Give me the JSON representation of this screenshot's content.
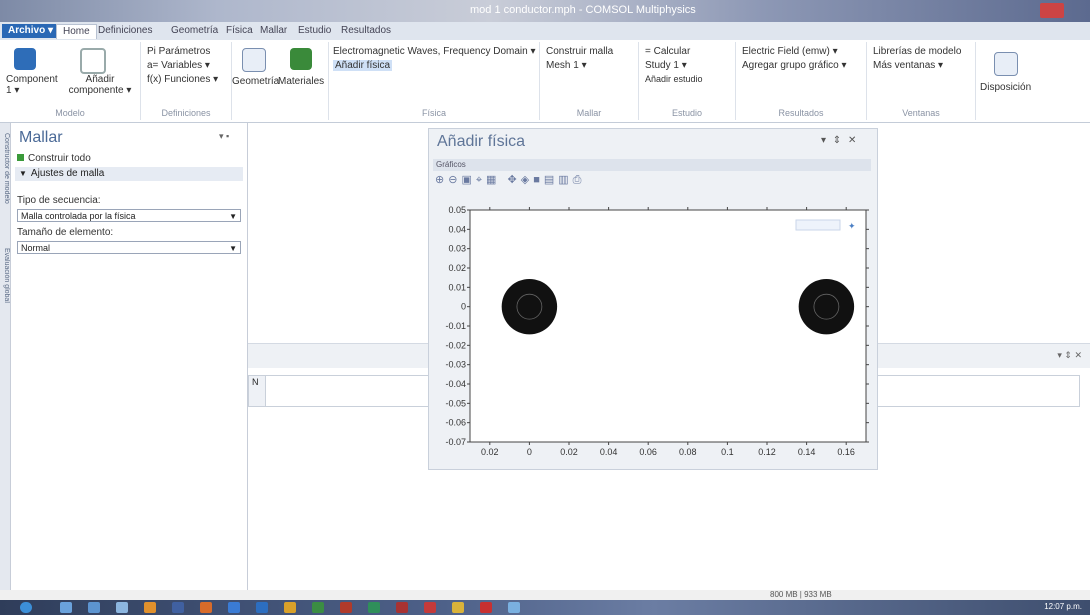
{
  "window": {
    "title": "mod 1 conductor.mph - COMSOL Multiphysics"
  },
  "tabs": [
    {
      "label": "Archivo ▾"
    },
    {
      "label": "Home"
    },
    {
      "label": "Definiciones"
    },
    {
      "label": "Geometría"
    },
    {
      "label": "Física"
    },
    {
      "label": "Mallar"
    },
    {
      "label": "Estudio"
    },
    {
      "label": "Resultados"
    }
  ],
  "ribbon": {
    "component": "Component 1 ▾",
    "add_component": "Añadir componente ▾",
    "parameters": "Pi Parámetros",
    "variables": "a= Variables ▾",
    "functions": "f(x) Funciones ▾",
    "geometry": "Geometría",
    "materials": "Materiales",
    "physics_item": "Electromagnetic Waves, Frequency Domain ▾",
    "add_physics": "Añadir física",
    "build_mesh": "Construir malla",
    "mesh": "Mesh 1 ▾",
    "compute": "= Calcular",
    "study": "Study 1 ▾",
    "add_study": "Añadir estudio",
    "plot1": "Electric Field (emw) ▾",
    "add_plot": "Agregar grupo gráfico ▾",
    "libraries": "Librerías de modelo",
    "more_windows": "Más ventanas ▾",
    "layout": "Disposición",
    "groups": {
      "model": "Modelo",
      "definitions": "Definiciones",
      "physics": "Física",
      "mesh": "Mallar",
      "study": "Estudio",
      "results": "Resultados",
      "windows": "Ventanas"
    }
  },
  "side_tabs": {
    "model_builder": "Constructor de modelo",
    "global_eval": "Evaluación global"
  },
  "left_panel": {
    "title": "Mallar",
    "build_all": "Construir todo",
    "section": "Ajustes de malla",
    "sequence_label": "Tipo de secuencia:",
    "sequence_value": "Malla controlada por la física",
    "size_label": "Tamaño de elemento:",
    "size_value": "Normal"
  },
  "popup": {
    "title": "Añadir física",
    "controls": "▾ ⇕ ✕",
    "graphics_label": "Gráficos"
  },
  "lower_panel": {
    "controls": "▾ ⇕ ✕"
  },
  "table": {
    "first_col": "N"
  },
  "status": {
    "memory": "800 MB | 933 MB"
  },
  "taskbar": {
    "clock": "12:07 p.m."
  },
  "chart_data": {
    "type": "scatter",
    "title": "",
    "xlabel": "",
    "ylabel": "",
    "xlim": [
      -0.03,
      0.17
    ],
    "ylim": [
      -0.07,
      0.05
    ],
    "xticks": [
      "0.02",
      "0",
      "0.02",
      "0.04",
      "0.06",
      "0.08",
      "0.1",
      "0.12",
      "0.14",
      "0.16"
    ],
    "xtick_values": [
      -0.02,
      0,
      0.02,
      0.04,
      0.06,
      0.08,
      0.1,
      0.12,
      0.14,
      0.16
    ],
    "yticks": [
      "0.05",
      "0.04",
      "0.03",
      "0.02",
      "0.01",
      "0",
      "-0.01",
      "-0.02",
      "-0.03",
      "-0.04",
      "-0.05",
      "-0.06",
      "-0.07"
    ],
    "ytick_values": [
      0.05,
      0.04,
      0.03,
      0.02,
      0.01,
      0,
      -0.01,
      -0.02,
      -0.03,
      -0.04,
      -0.05,
      -0.06,
      -0.07
    ],
    "points": [
      {
        "x": 0.0,
        "y": 0.0,
        "r": 0.004
      },
      {
        "x": 0.15,
        "y": 0.0,
        "r": 0.004
      }
    ],
    "colors": {
      "marker": "#111111",
      "frame": "#444444"
    }
  }
}
